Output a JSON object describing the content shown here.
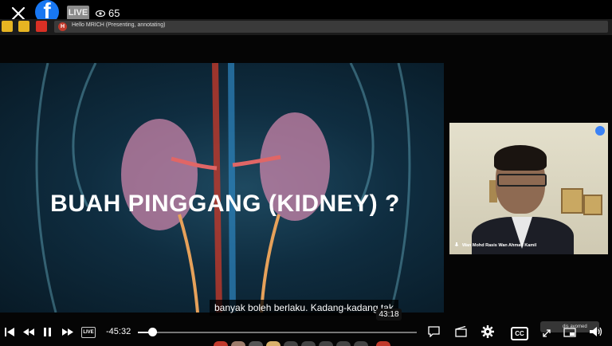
{
  "header": {
    "live_label": "LIVE",
    "viewer_count": "65"
  },
  "presenter_bar": {
    "avatar_letter": "H",
    "text": "Hello MRICH (Presenting, annotating)"
  },
  "slide": {
    "title": "BUAH PINGGANG (KIDNEY) ?"
  },
  "caption": {
    "text": "banyak boleh berlaku. Kadang-kadang tak",
    "hover_time": "43:18"
  },
  "camera": {
    "name": "Wan Mohd Rasis Wan Ahmad Kamil"
  },
  "controls": {
    "live_label": "LIVE",
    "time_remaining": "-45:32",
    "progress": 0.05,
    "cc_label": "CC",
    "chip_text": "dis ayomed"
  },
  "colors": {
    "facebook_blue": "#1877f2",
    "record_red": "#d93025",
    "warning_yellow": "#e6b422"
  }
}
